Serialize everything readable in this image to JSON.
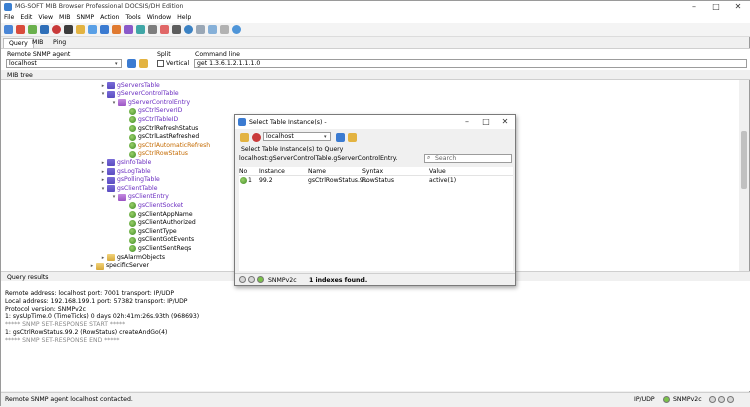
{
  "app": {
    "title": "MG-SOFT MIB Browser Professional DOCSIS/DH Edition"
  },
  "window_controls": {
    "minimize": "–",
    "maximize": "□",
    "close": "✕"
  },
  "menu": [
    "File",
    "Edit",
    "View",
    "MIB",
    "SNMP",
    "Action",
    "Tools",
    "Window",
    "Help"
  ],
  "toolbar_icons": [
    "connect-icon",
    "disconnect-icon",
    "mib-icon",
    "query-icon",
    "stop-icon",
    "get-icon",
    "getnext-icon",
    "walk-icon",
    "table-icon",
    "set-icon",
    "trap-icon",
    "ping-icon",
    "options-icon",
    "contact-icon",
    "print-icon",
    "help-icon",
    "window-icon",
    "tile-icon",
    "cascade-icon",
    "info-icon"
  ],
  "tabs": [
    "Query",
    "MIB",
    "Ping"
  ],
  "agent": {
    "label": "Remote SNMP agent",
    "value": "localhost"
  },
  "split": {
    "label": "Split",
    "checkbox": "Vertical"
  },
  "command": {
    "label": "Command line",
    "value": "get 1.3.6.1.2.1.1.1.0"
  },
  "mib_tree": {
    "label": "MIB tree",
    "nodes": [
      {
        "text": "gServersTable",
        "type": "table",
        "exp": "▸",
        "color": "purple"
      },
      {
        "text": "gServerControlTable",
        "type": "table",
        "exp": "▾",
        "color": "purple"
      },
      {
        "text": "gServerControlEntry",
        "type": "entry",
        "exp": "▾",
        "color": "purple"
      },
      {
        "text": "gsCtrlServerID",
        "type": "leaf",
        "exp": "",
        "color": "purple"
      },
      {
        "text": "gsCtrlTableID",
        "type": "leaf",
        "exp": "",
        "color": "purple"
      },
      {
        "text": "gsCtrlRefreshStatus",
        "type": "leaf",
        "exp": "",
        "color": "black"
      },
      {
        "text": "gsCtrlLastRefreshed",
        "type": "leaf",
        "exp": "",
        "color": "black"
      },
      {
        "text": "gsCtrlAutomaticRefresh",
        "type": "leaf",
        "exp": "",
        "color": "orange"
      },
      {
        "text": "gsCtrlRowStatus",
        "type": "leaf",
        "exp": "",
        "color": "orange"
      },
      {
        "text": "gsInfoTable",
        "type": "table",
        "exp": "▸",
        "color": "purple"
      },
      {
        "text": "gsLogTable",
        "type": "table",
        "exp": "▸",
        "color": "purple"
      },
      {
        "text": "gsPollingTable",
        "type": "table",
        "exp": "▸",
        "color": "purple"
      },
      {
        "text": "gsClientTable",
        "type": "table",
        "exp": "▾",
        "color": "purple"
      },
      {
        "text": "gsClientEntry",
        "type": "entry",
        "exp": "▾",
        "color": "purple"
      },
      {
        "text": "gsClientSocket",
        "type": "leaf",
        "exp": "",
        "color": "purple"
      },
      {
        "text": "gsClientAppName",
        "type": "leaf",
        "exp": "",
        "color": "black"
      },
      {
        "text": "gsClientAuthorized",
        "type": "leaf",
        "exp": "",
        "color": "black"
      },
      {
        "text": "gsClientType",
        "type": "leaf",
        "exp": "",
        "color": "black"
      },
      {
        "text": "gsClientGotEvents",
        "type": "leaf",
        "exp": "",
        "color": "black"
      },
      {
        "text": "gsClientSentReqs",
        "type": "leaf",
        "exp": "",
        "color": "black"
      },
      {
        "text": "gsAlarmObjects",
        "type": "folder",
        "exp": "▸",
        "color": "black"
      },
      {
        "text": "specificServer",
        "type": "folder",
        "exp": "▸",
        "color": "black"
      }
    ]
  },
  "query_results": {
    "label": "Query results",
    "lines": [
      "Remote address: localhost  port: 7001 transport: IP/UDP",
      "Local address: 192.168.199.1  port: 57382 transport: IP/UDP",
      "Protocol version: SNMPv2c",
      "1: sysUpTime.0 (TimeTicks) 0 days 02h:41m:26s.93th (968693)",
      "***** SNMP SET-RESPONSE START *****",
      "1: gsCtrlRowStatus.99.2 (RowStatus) createAndGo(4)",
      "***** SNMP SET-RESPONSE END *****"
    ]
  },
  "status_bar": {
    "message": "Remote SNMP agent localhost contacted.",
    "transport": "IP/UDP",
    "version": "SNMPv2c"
  },
  "dialog": {
    "title": "Select Table Instance(s) -",
    "controls": {
      "minimize": "–",
      "maximize": "□",
      "close": "✕"
    },
    "agent": "localhost",
    "prompt": "Select Table Instance(s) to Query",
    "path": "localhost:gServerControlTable.gServerControlEntry.",
    "search_placeholder": "Search",
    "columns": [
      "No",
      "Instance",
      "Name",
      "Syntax",
      "Value"
    ],
    "rows": [
      {
        "no": "1",
        "instance": "99.2",
        "name": "gsCtrlRowStatus.9...",
        "syntax": "RowStatus",
        "value": "active(1)"
      }
    ],
    "status": {
      "version": "SNMPv2c",
      "message": "1 indexes found."
    }
  }
}
